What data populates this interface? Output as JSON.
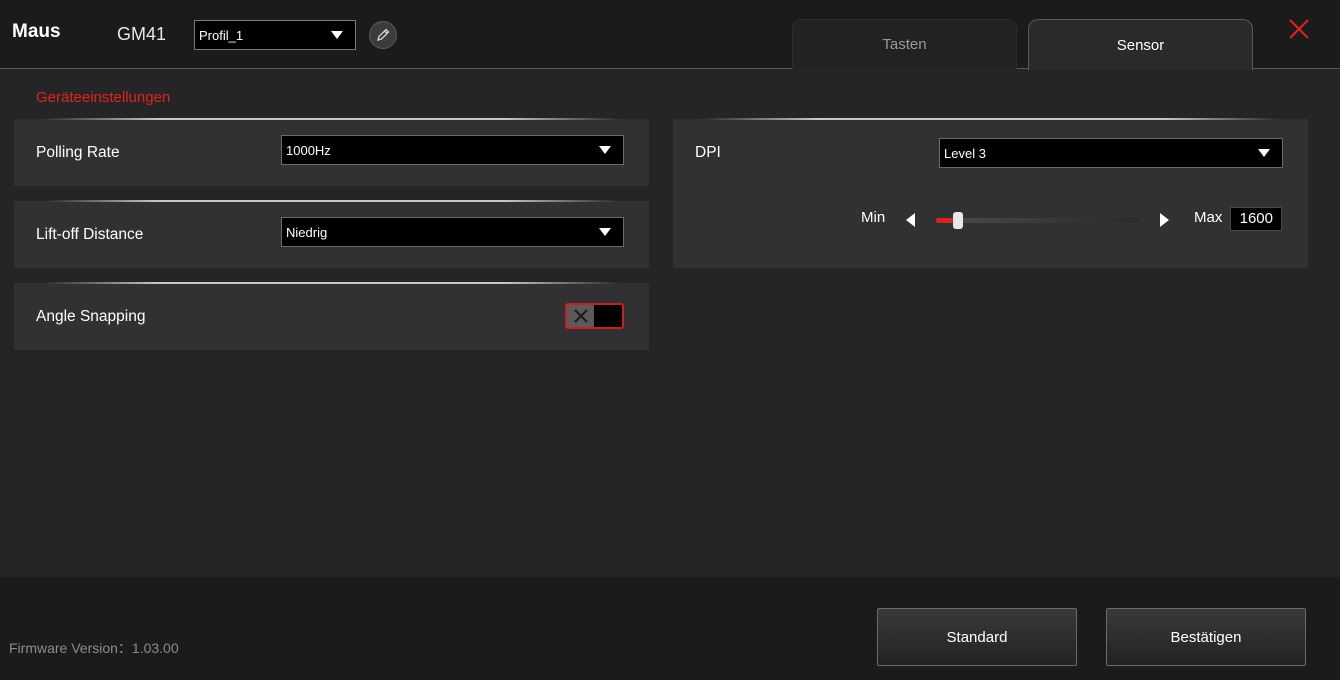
{
  "header": {
    "app_title": "Maus",
    "device_name": "GM41",
    "profile": {
      "selected": "Profil_1"
    },
    "tabs": [
      {
        "label": "Tasten",
        "active": false
      },
      {
        "label": "Sensor",
        "active": true
      }
    ]
  },
  "section_title": "Geräteeinstellungen",
  "settings": {
    "polling_rate": {
      "label": "Polling Rate",
      "value": "1000Hz"
    },
    "lift_off": {
      "label": "Lift-off Distance",
      "value": "Niedrig"
    },
    "angle_snapping": {
      "label": "Angle Snapping",
      "enabled": false
    }
  },
  "dpi": {
    "label": "DPI",
    "level": "Level 3",
    "min_label": "Min",
    "max_label": "Max",
    "value": "1600",
    "slider_fraction": 0.11
  },
  "footer": {
    "firmware": "Firmware Version：1.03.00",
    "standard_label": "Standard",
    "confirm_label": "Bestätigen"
  },
  "colors": {
    "accent": "#e0231b",
    "background": "#252527",
    "panel": "#313133",
    "bar": "#1b1b1c"
  },
  "icons": {
    "edit": "pencil-icon",
    "close": "close-icon",
    "toggle_off": "x-icon"
  }
}
